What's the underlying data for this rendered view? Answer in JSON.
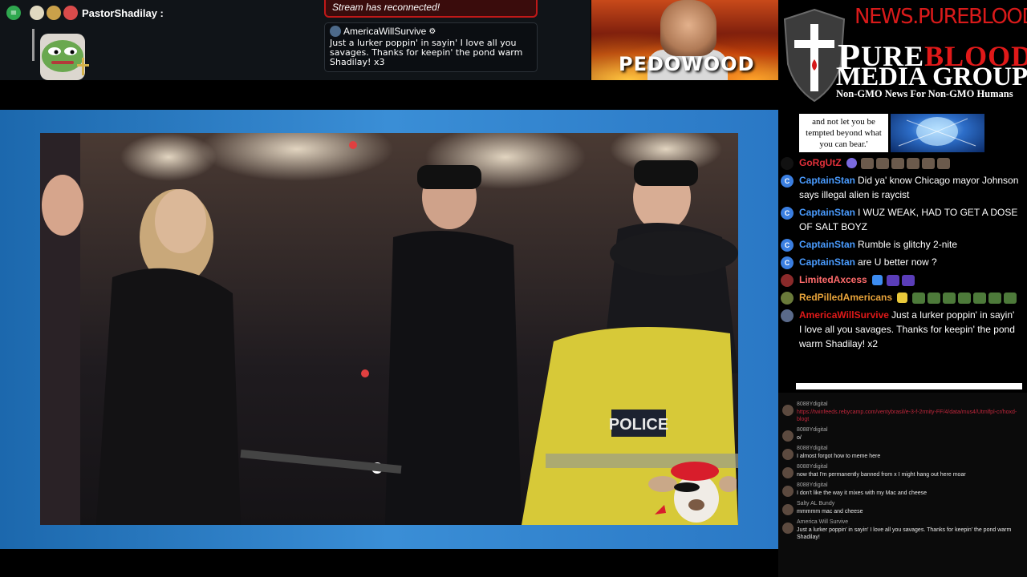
{
  "top": {
    "user": "PastorShadilay :",
    "reconnect": "Stream has reconnected!",
    "popup": {
      "user": "AmericaWillSurvive",
      "message": "Just a lurker poppin' in sayin' I love all you savages. Thanks for keepin' the pond warm Shadilay! x3"
    },
    "thumbnail_text": "PEDOWOOD"
  },
  "logo": {
    "url": "NEWS.PUREBLOOD.MEDIA",
    "line1_a": "URE",
    "line1_b": "BLOOD",
    "line2": "MEDIA GROUP",
    "tagline": "Non-GMO News For Non-GMO Humans"
  },
  "video": {
    "police_label": "POLICE"
  },
  "verse": "and not let you be tempted beyond what you can bear.'",
  "chat": [
    {
      "user": "GoRgUtZ",
      "color": "#e0303a",
      "text": "",
      "emotes": 6
    },
    {
      "user": "CaptainStan",
      "color": "#4a9cff",
      "text": "Did ya' know Chicago mayor Johnson says illegal alien is raycist"
    },
    {
      "user": "CaptainStan",
      "color": "#4a9cff",
      "text": "I WUZ WEAK, HAD TO GET A DOSE OF SALT BOYZ"
    },
    {
      "user": "CaptainStan",
      "color": "#4a9cff",
      "text": "Rumble is glitchy 2-nite"
    },
    {
      "user": "CaptainStan",
      "color": "#4a9cff",
      "text": "are U better now ?"
    },
    {
      "user": "LimitedAxcess",
      "color": "#ff6b6b",
      "text": ""
    },
    {
      "user": "RedPilledAmericans",
      "color": "#e8a33a",
      "text": ""
    },
    {
      "user": "AmericaWillSurvive",
      "color": "#e01919",
      "text": "Just a lurker poppin' in sayin' I love all you savages. Thanks for keepin' the pond warm Shadilay! x2"
    }
  ],
  "chat2": [
    {
      "user": "8088Ydigital",
      "text": "https://twinfeeds.rebycamp.com/ventybrasil/e-3-f-2rmity-FF/4/data/mus4/Utmlfpl-cr/hoxd-blogt",
      "link": true
    },
    {
      "user": "8088Ydigital",
      "text": "o/"
    },
    {
      "user": "8088Ydigital",
      "text": "I almost forgot how to meme here"
    },
    {
      "user": "8088Ydigital",
      "text": "now that I'm permanently banned from x I might hang out here moar"
    },
    {
      "user": "8088Ydigital",
      "text": "I don't like the way it mixes with my Mac and cheese"
    },
    {
      "user": "Salty AL Bundy",
      "text": "mmmmm mac and cheese"
    },
    {
      "user": "America Will Survive",
      "text": "Just a lurker poppin' in sayin' I love all you savages. Thanks for keepin' the pond warm Shadilay!"
    }
  ]
}
